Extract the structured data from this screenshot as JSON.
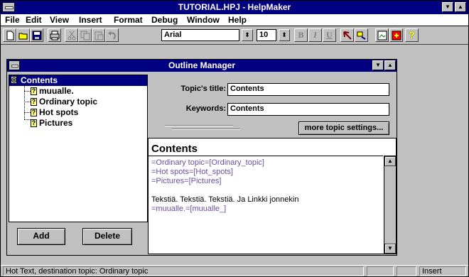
{
  "app": {
    "title": "TUTORIAL.HPJ - HelpMaker"
  },
  "menu": [
    "File",
    "Edit",
    "View",
    "Insert",
    "Format",
    "Debug",
    "Window",
    "Help"
  ],
  "toolbar": {
    "font_name": "Arial",
    "font_size": "10",
    "bold_label": "B",
    "italic_label": "I",
    "underline_label": "U",
    "help_label": "?"
  },
  "outline_manager": {
    "title": "Outline Manager",
    "tree": {
      "root": "Contents",
      "children": [
        "muualle.",
        "Ordinary topic",
        "Hot spots",
        "Pictures"
      ]
    },
    "add_label": "Add",
    "delete_label": "Delete",
    "topic_title_label": "Topic's title:",
    "topic_title_value": "Contents",
    "keywords_label": "Keywords:",
    "keywords_value": "Contents",
    "more_settings_label": "more topic settings...",
    "editor": {
      "heading": "Contents",
      "lines": [
        {
          "text": "=Ordinary topic=[Ordinary_topic]",
          "type": "link"
        },
        {
          "text": "=Hot spots=[Hot_spots]",
          "type": "link"
        },
        {
          "text": "=Pictures=[Pictures]",
          "type": "link"
        },
        {
          "text": "",
          "type": "plain"
        },
        {
          "text": "Tekstiä. Tekstiä. Tekstiä. Ja Linkki jonnekin",
          "type": "plain"
        },
        {
          "text": "=muualle.=[muualle_]",
          "type": "link"
        }
      ]
    }
  },
  "status": {
    "message": "Hot Text, destination topic: Ordinary topic",
    "mode": "Insert"
  }
}
